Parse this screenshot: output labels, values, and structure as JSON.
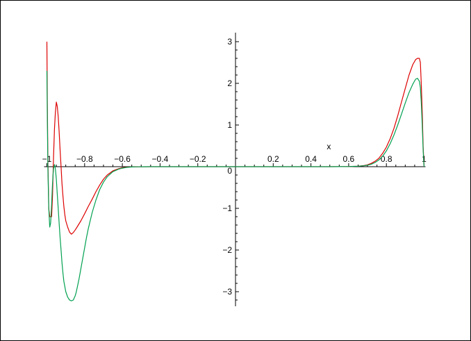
{
  "chart_data": {
    "type": "line",
    "title": "",
    "xlabel": "x",
    "ylabel": "",
    "xlim": [
      -1,
      1
    ],
    "ylim": [
      -3.35,
      3.2
    ],
    "grid": false,
    "x_ticks": [
      {
        "value": -1,
        "label": "-1"
      },
      {
        "value": -0.8,
        "label": "-0.8"
      },
      {
        "value": -0.6,
        "label": "-0.6"
      },
      {
        "value": -0.4,
        "label": "-0.4"
      },
      {
        "value": -0.2,
        "label": "-0.2"
      },
      {
        "value": 0.2,
        "label": "0.2"
      },
      {
        "value": 0.4,
        "label": "0.4"
      },
      {
        "value": 0.6,
        "label": "0.6"
      },
      {
        "value": 0.8,
        "label": "0.8"
      },
      {
        "value": 1,
        "label": "1"
      }
    ],
    "y_ticks": [
      {
        "value": 3,
        "label": "3"
      },
      {
        "value": 2,
        "label": "2"
      },
      {
        "value": 1,
        "label": "1"
      },
      {
        "value": 0,
        "label": "0"
      },
      {
        "value": -1,
        "label": "-1"
      },
      {
        "value": -2,
        "label": "-2"
      },
      {
        "value": -3,
        "label": "-3"
      }
    ],
    "series": [
      {
        "color": "#dd0000",
        "x": [
          -1.0,
          -0.998,
          -0.995,
          -0.99,
          -0.985,
          -0.98,
          -0.975,
          -0.97,
          -0.965,
          -0.96,
          -0.955,
          -0.95,
          -0.945,
          -0.94,
          -0.935,
          -0.93,
          -0.925,
          -0.92,
          -0.915,
          -0.91,
          -0.905,
          -0.9,
          -0.89,
          -0.88,
          -0.87,
          -0.86,
          -0.85,
          -0.84,
          -0.82,
          -0.8,
          -0.78,
          -0.76,
          -0.74,
          -0.72,
          -0.7,
          -0.68,
          -0.65,
          -0.62,
          -0.6,
          -0.58,
          -0.55,
          -0.52,
          -0.5,
          -0.45,
          -0.4,
          -0.3,
          -0.2,
          -0.1,
          0.0,
          0.1,
          0.2,
          0.3,
          0.4,
          0.5,
          0.55,
          0.6,
          0.62,
          0.65,
          0.68,
          0.7,
          0.72,
          0.74,
          0.76,
          0.78,
          0.8,
          0.82,
          0.84,
          0.86,
          0.88,
          0.9,
          0.92,
          0.94,
          0.955,
          0.965,
          0.975,
          0.98,
          0.985,
          0.99,
          0.995,
          0.998,
          1.0
        ],
        "y": [
          3.0,
          1.8,
          0.2,
          -1.0,
          -1.2,
          -1.2,
          -1.2,
          -0.7,
          0.2,
          0.9,
          1.3,
          1.55,
          1.45,
          1.2,
          0.85,
          0.4,
          0.0,
          -0.4,
          -0.7,
          -0.95,
          -1.15,
          -1.3,
          -1.45,
          -1.57,
          -1.62,
          -1.58,
          -1.52,
          -1.45,
          -1.3,
          -1.13,
          -0.95,
          -0.78,
          -0.6,
          -0.44,
          -0.3,
          -0.2,
          -0.1,
          -0.05,
          -0.025,
          -0.012,
          -0.005,
          -0.002,
          -0.001,
          0,
          0,
          0,
          0,
          0,
          0,
          0,
          0,
          0,
          0,
          0,
          0.001,
          0.003,
          0.006,
          0.012,
          0.025,
          0.045,
          0.08,
          0.13,
          0.2,
          0.32,
          0.47,
          0.67,
          0.92,
          1.22,
          1.55,
          1.88,
          2.2,
          2.45,
          2.57,
          2.6,
          2.6,
          2.5,
          2.0,
          1.3,
          0.5,
          0.15,
          0.0
        ]
      },
      {
        "color": "#00a050",
        "x": [
          -1.0,
          -0.998,
          -0.995,
          -0.99,
          -0.985,
          -0.98,
          -0.975,
          -0.97,
          -0.965,
          -0.96,
          -0.955,
          -0.95,
          -0.945,
          -0.94,
          -0.935,
          -0.93,
          -0.925,
          -0.92,
          -0.915,
          -0.91,
          -0.9,
          -0.89,
          -0.88,
          -0.87,
          -0.86,
          -0.85,
          -0.845,
          -0.84,
          -0.83,
          -0.82,
          -0.81,
          -0.8,
          -0.79,
          -0.78,
          -0.76,
          -0.74,
          -0.72,
          -0.7,
          -0.68,
          -0.65,
          -0.62,
          -0.6,
          -0.58,
          -0.55,
          -0.52,
          -0.5,
          -0.45,
          -0.4,
          -0.3,
          -0.2,
          -0.1,
          0.0,
          0.1,
          0.2,
          0.3,
          0.4,
          0.5,
          0.55,
          0.6,
          0.62,
          0.65,
          0.68,
          0.7,
          0.72,
          0.74,
          0.76,
          0.78,
          0.8,
          0.82,
          0.84,
          0.86,
          0.88,
          0.9,
          0.92,
          0.94,
          0.955,
          0.965,
          0.975,
          0.98,
          0.985,
          0.99,
          0.995,
          0.998,
          1.0
        ],
        "y": [
          2.3,
          1.4,
          0.0,
          -1.0,
          -1.45,
          -1.35,
          -0.9,
          -0.4,
          -0.05,
          0.05,
          -0.05,
          -0.3,
          -0.65,
          -1.0,
          -1.35,
          -1.7,
          -2.0,
          -2.3,
          -2.55,
          -2.75,
          -3.0,
          -3.13,
          -3.2,
          -3.22,
          -3.2,
          -3.1,
          -3.02,
          -2.92,
          -2.7,
          -2.45,
          -2.2,
          -1.95,
          -1.7,
          -1.48,
          -1.1,
          -0.8,
          -0.55,
          -0.37,
          -0.24,
          -0.12,
          -0.06,
          -0.035,
          -0.018,
          -0.007,
          -0.003,
          -0.001,
          0,
          0,
          0,
          0,
          0,
          0,
          0,
          0,
          0,
          0,
          0,
          0.001,
          0.003,
          0.006,
          0.012,
          0.022,
          0.035,
          0.06,
          0.1,
          0.16,
          0.25,
          0.38,
          0.55,
          0.76,
          1.0,
          1.26,
          1.53,
          1.78,
          1.98,
          2.1,
          2.12,
          2.05,
          1.9,
          1.55,
          1.0,
          0.4,
          0.1,
          0.0
        ]
      }
    ]
  }
}
